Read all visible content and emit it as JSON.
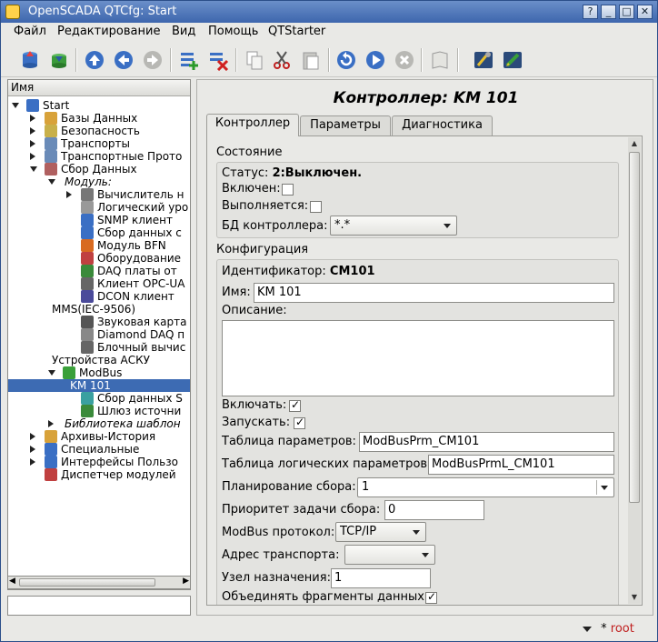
{
  "window": {
    "title": "OpenSCADA QTCfg: Start",
    "buttons": [
      "?",
      "_",
      "□",
      "✕"
    ]
  },
  "menu": [
    "Файл",
    "Редактирование",
    "Вид",
    "Помощь",
    "QTStarter"
  ],
  "toolbar": {
    "icons": [
      "db-load-icon",
      "db-save-icon",
      "up-icon",
      "back-icon",
      "forward-icon",
      "add-item-icon",
      "delete-item-icon",
      "copy-icon",
      "cut-icon",
      "paste-icon",
      "refresh-icon",
      "start-icon",
      "stop-icon",
      "manual-icon",
      "config-icon",
      "edit-icon"
    ]
  },
  "tree": {
    "header": "Имя",
    "items": [
      {
        "label": "Start",
        "indent": 0,
        "arrow": "down",
        "icon": "#3a6fc4",
        "italic": false
      },
      {
        "label": "Базы Данных",
        "indent": 1,
        "arrow": "right",
        "icon": "#d8a23a",
        "italic": false
      },
      {
        "label": "Безопасность",
        "indent": 1,
        "arrow": "right",
        "icon": "#c8b04a",
        "italic": false
      },
      {
        "label": "Транспорты",
        "indent": 1,
        "arrow": "right",
        "icon": "#6a8bb8",
        "italic": false
      },
      {
        "label": "Транспортные Прото",
        "indent": 1,
        "arrow": "right",
        "icon": "#6a8bb8",
        "italic": false
      },
      {
        "label": "Сбор Данных",
        "indent": 1,
        "arrow": "down",
        "icon": "#b06060",
        "italic": false
      },
      {
        "label": "Модуль:",
        "indent": 2,
        "arrow": "down",
        "icon": "",
        "italic": true
      },
      {
        "label": "Вычислитель н",
        "indent": 3,
        "arrow": "right",
        "icon": "#777777",
        "italic": false
      },
      {
        "label": "Логический уро",
        "indent": 3,
        "arrow": "",
        "icon": "#999999",
        "italic": false
      },
      {
        "label": "SNMP клиент",
        "indent": 3,
        "arrow": "",
        "icon": "#3a6fc4",
        "italic": false
      },
      {
        "label": "Сбор данных с",
        "indent": 3,
        "arrow": "",
        "icon": "#3a6fc4",
        "italic": false
      },
      {
        "label": "Модуль BFN",
        "indent": 3,
        "arrow": "",
        "icon": "#d86a20",
        "italic": false
      },
      {
        "label": "Оборудование",
        "indent": 3,
        "arrow": "",
        "icon": "#c04040",
        "italic": false
      },
      {
        "label": "DAQ платы от",
        "indent": 3,
        "arrow": "",
        "icon": "#3a8a3a",
        "italic": false
      },
      {
        "label": "Клиент OPC-UA",
        "indent": 3,
        "arrow": "",
        "icon": "#666666",
        "italic": false
      },
      {
        "label": "DCON клиент",
        "indent": 3,
        "arrow": "",
        "icon": "#4a4a9a",
        "italic": false
      },
      {
        "label": "MMS(IEC-9506)",
        "indent": 2,
        "arrow": "",
        "icon": "",
        "italic": false
      },
      {
        "label": "Звуковая карта",
        "indent": 3,
        "arrow": "",
        "icon": "#555555",
        "italic": false
      },
      {
        "label": "Diamond DAQ п",
        "indent": 3,
        "arrow": "",
        "icon": "#888888",
        "italic": false
      },
      {
        "label": "Блочный вычис",
        "indent": 3,
        "arrow": "",
        "icon": "#666666",
        "italic": false
      },
      {
        "label": "Устройства АСКУ",
        "indent": 2,
        "arrow": "",
        "icon": "",
        "italic": false
      },
      {
        "label": "ModBus",
        "indent": 2,
        "arrow": "down",
        "icon": "#3aa03a",
        "italic": false
      },
      {
        "label": "KM 101",
        "indent": 3,
        "arrow": "",
        "icon": "",
        "italic": false,
        "selected": true
      },
      {
        "label": "Сбор данных S",
        "indent": 3,
        "arrow": "",
        "icon": "#3aa0a0",
        "italic": false
      },
      {
        "label": "Шлюз источни",
        "indent": 3,
        "arrow": "",
        "icon": "#3a8a3a",
        "italic": false
      },
      {
        "label": "Библиотека шаблон",
        "indent": 2,
        "arrow": "right",
        "icon": "",
        "italic": true
      },
      {
        "label": "Архивы-История",
        "indent": 1,
        "arrow": "right",
        "icon": "#d8a23a",
        "italic": false
      },
      {
        "label": "Специальные",
        "indent": 1,
        "arrow": "right",
        "icon": "#3a6fc4",
        "italic": false
      },
      {
        "label": "Интерфейсы Пользо",
        "indent": 1,
        "arrow": "right",
        "icon": "#3a6fc4",
        "italic": false
      },
      {
        "label": "Диспетчер модулей",
        "indent": 1,
        "arrow": "",
        "icon": "#c04040",
        "italic": false
      }
    ]
  },
  "page": {
    "title": "Контроллер: KM 101",
    "tabs": [
      "Контроллер",
      "Параметры",
      "Диагностика"
    ],
    "state": {
      "group_title": "Состояние",
      "status_label": "Статус:",
      "status_value": "2:Выключен.",
      "enabled_label": "Включен:",
      "enabled": false,
      "running_label": "Выполняется:",
      "running": false,
      "db_label": "БД контроллера:",
      "db_value": "*.*"
    },
    "config": {
      "group_title": "Конфигурация",
      "id_label": "Идентификатор:",
      "id_value": "CM101",
      "name_label": "Имя:",
      "name_value": "KM 101",
      "descr_label": "Описание:",
      "descr_value": "",
      "enable_label": "Включать:",
      "enable": true,
      "start_label": "Запускать:",
      "start": true,
      "prm_table_label": "Таблица параметров:",
      "prm_table_value": "ModBusPrm_CM101",
      "prml_table_label": "Таблица логических параметров:",
      "prml_table_value": "ModBusPrmL_CM101",
      "schedule_label": "Планирование сбора:",
      "schedule_value": "1",
      "priority_label": "Приоритет задачи сбора:",
      "priority_value": "0",
      "protocol_label": "ModBus протокол:",
      "protocol_value": "TCP/IP",
      "transport_label": "Адрес транспорта:",
      "transport_value": "",
      "node_label": "Узел назначения:",
      "node_value": "1",
      "merge_label": "Объединять фрагменты данных:",
      "merge": true
    }
  },
  "statusbar": {
    "user": "root",
    "star": "*"
  }
}
